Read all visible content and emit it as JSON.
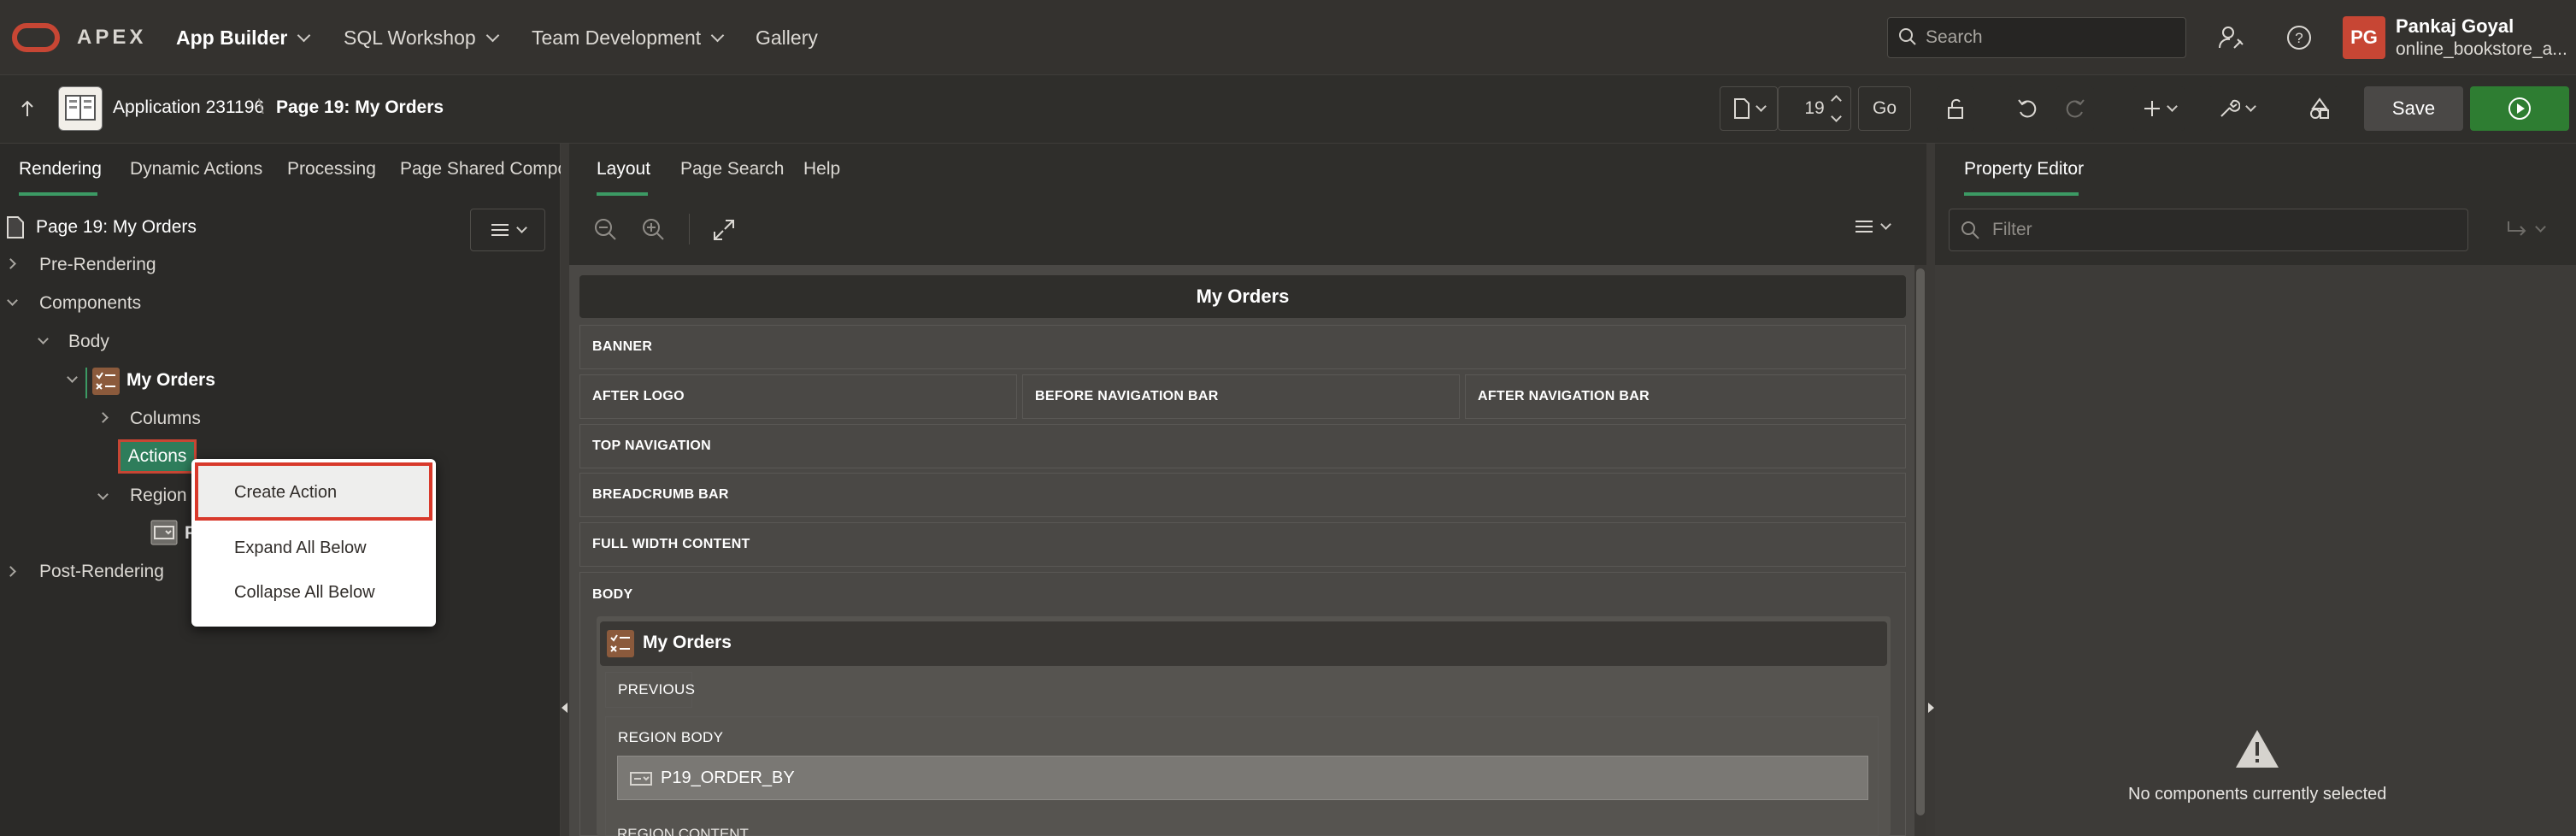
{
  "topnav": {
    "brand": "APEX",
    "menu": [
      {
        "label": "App Builder",
        "active": true
      },
      {
        "label": "SQL Workshop",
        "active": false
      },
      {
        "label": "Team Development",
        "active": false
      },
      {
        "label": "Gallery",
        "active": false
      }
    ],
    "search_placeholder": "Search",
    "user": {
      "initials": "PG",
      "name": "Pankaj Goyal",
      "workspace": "online_bookstore_a..."
    }
  },
  "toolbar": {
    "application": "Application 231196",
    "page": "Page 19: My Orders",
    "page_number": "19",
    "go_label": "Go",
    "save_label": "Save"
  },
  "left_tabs": [
    "Rendering",
    "Dynamic Actions",
    "Processing",
    "Page Shared Compor"
  ],
  "tree": {
    "root": "Page 19: My Orders",
    "pre_rendering": "Pre-Rendering",
    "components": "Components",
    "body": "Body",
    "region": "My Orders",
    "columns": "Columns",
    "actions": "Actions",
    "region_body": "Region B",
    "item_partial": "P",
    "post_rendering": "Post-Rendering"
  },
  "context_menu": {
    "items": [
      "Create Action",
      "Expand All Below",
      "Collapse All Below"
    ]
  },
  "middle_tabs": [
    "Layout",
    "Page Search",
    "Help"
  ],
  "layout": {
    "page_title": "My Orders",
    "positions": {
      "banner": "BANNER",
      "after_logo": "AFTER LOGO",
      "before_nav": "BEFORE NAVIGATION BAR",
      "after_nav": "AFTER NAVIGATION BAR",
      "top_nav": "TOP NAVIGATION",
      "breadcrumb": "BREADCRUMB BAR",
      "full_width": "FULL WIDTH CONTENT",
      "body": "BODY"
    },
    "region": {
      "title": "My Orders",
      "previous": "PREVIOUS",
      "region_body": "REGION BODY",
      "item": "P19_ORDER_BY",
      "region_content": "REGION CONTENT"
    }
  },
  "property_editor": {
    "tab": "Property Editor",
    "filter_placeholder": "Filter",
    "empty_message": "No components currently selected"
  },
  "colors": {
    "accent_green": "#3c9a64",
    "oracle_red": "#c74634",
    "run_green": "#2e7d32"
  }
}
